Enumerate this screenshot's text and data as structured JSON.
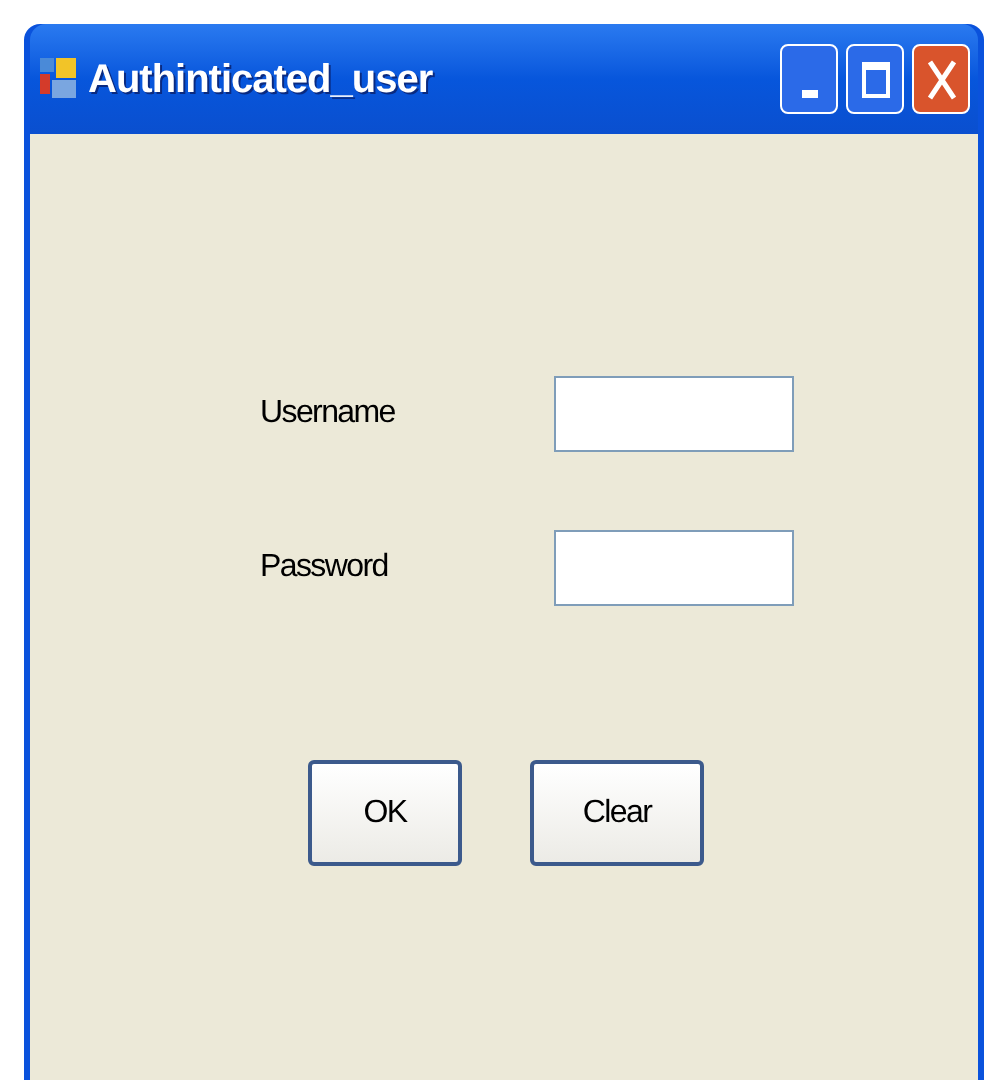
{
  "window": {
    "title": "Authinticated_user"
  },
  "fields": [
    {
      "label": "Username"
    },
    {
      "label": "Password"
    }
  ],
  "buttons": [
    "OK",
    "Clear"
  ]
}
